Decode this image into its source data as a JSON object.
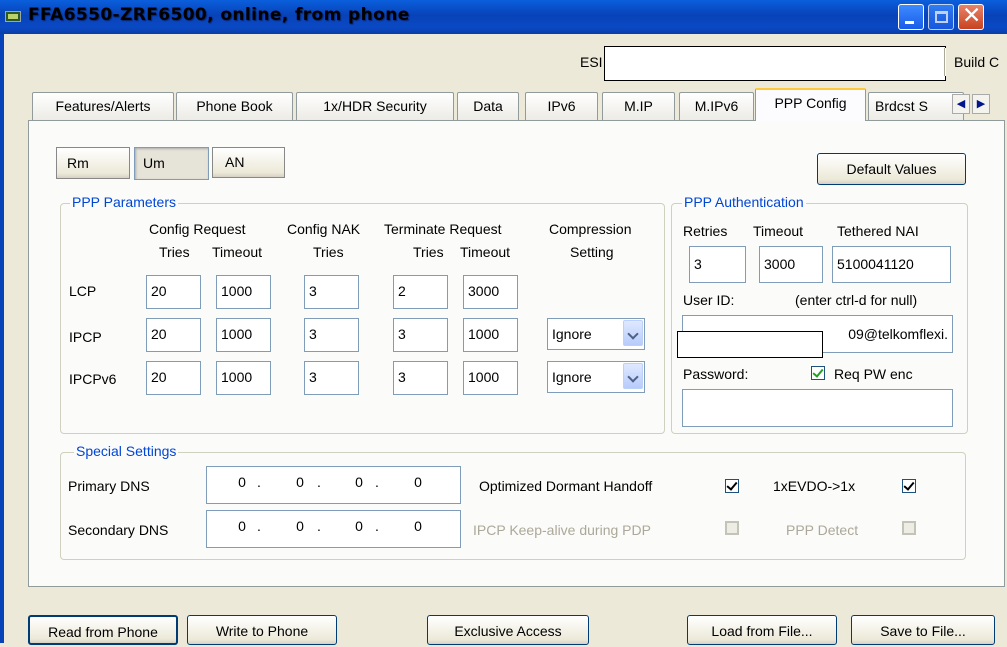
{
  "window": {
    "title": "FFA6550-ZRF6500, online, from phone"
  },
  "status": {
    "esn_label": "ESI",
    "build_label": "Build C"
  },
  "tabs": [
    {
      "label": "Features/Alerts"
    },
    {
      "label": "Phone Book"
    },
    {
      "label": "1x/HDR Security"
    },
    {
      "label": "Data"
    },
    {
      "label": "IPv6"
    },
    {
      "label": "M.IP"
    },
    {
      "label": "M.IPv6"
    },
    {
      "label": "PPP Config"
    },
    {
      "label": "Brdcst S"
    }
  ],
  "tab_scroll": {
    "left": "◀",
    "right": "▶"
  },
  "segments": [
    {
      "label": "Rm"
    },
    {
      "label": "Um"
    },
    {
      "label": "AN"
    }
  ],
  "default_values_label": "Default Values",
  "ppp_params": {
    "title": "PPP Parameters",
    "headers": {
      "config_request": "Config Request",
      "config_nak": "Config NAK",
      "terminate_request": "Terminate Request",
      "compression": "Compression",
      "tries": "Tries",
      "timeout": "Timeout",
      "setting": "Setting"
    },
    "rows": [
      {
        "label": "LCP",
        "cr_tries": "20",
        "cr_timeout": "1000",
        "nak_tries": "3",
        "tr_tries": "2",
        "tr_timeout": "3000",
        "compression": ""
      },
      {
        "label": "IPCP",
        "cr_tries": "20",
        "cr_timeout": "1000",
        "nak_tries": "3",
        "tr_tries": "3",
        "tr_timeout": "1000",
        "compression": "Ignore"
      },
      {
        "label": "IPCPv6",
        "cr_tries": "20",
        "cr_timeout": "1000",
        "nak_tries": "3",
        "tr_tries": "3",
        "tr_timeout": "1000",
        "compression": "Ignore"
      }
    ]
  },
  "ppp_auth": {
    "title": "PPP Authentication",
    "retries_label": "Retries",
    "timeout_label": "Timeout",
    "tethered_nai_label": "Tethered NAI",
    "retries": "3",
    "timeout": "3000",
    "tethered_nai": "5100041120",
    "user_id_label": "User ID:",
    "user_id_hint": "(enter ctrl-d for null)",
    "user_id_visible": "09@telkomflexi.",
    "password_label": "Password:",
    "req_pw_enc_label": "Req PW enc",
    "password": ""
  },
  "special": {
    "title": "Special Settings",
    "primary_dns_label": "Primary DNS",
    "secondary_dns_label": "Secondary DNS",
    "primary_dns": [
      "0",
      "0",
      "0",
      "0"
    ],
    "secondary_dns": [
      "0",
      "0",
      "0",
      "0"
    ],
    "dot": ".",
    "opt_dormant_label": "Optimized Dormant Handoff",
    "evdo_label": "1xEVDO->1x",
    "ipcp_keepalive_label": "IPCP Keep-alive during PDP",
    "ppp_detect_label": "PPP Detect"
  },
  "bottom_buttons": {
    "read": "Read from Phone",
    "write": "Write to Phone",
    "exclusive": "Exclusive Access",
    "load": "Load from File...",
    "save": "Save to File..."
  },
  "colors": {
    "title_bar": "#0842b8",
    "group_title": "#0046d5",
    "dialog_bg": "#ECE9D8"
  }
}
